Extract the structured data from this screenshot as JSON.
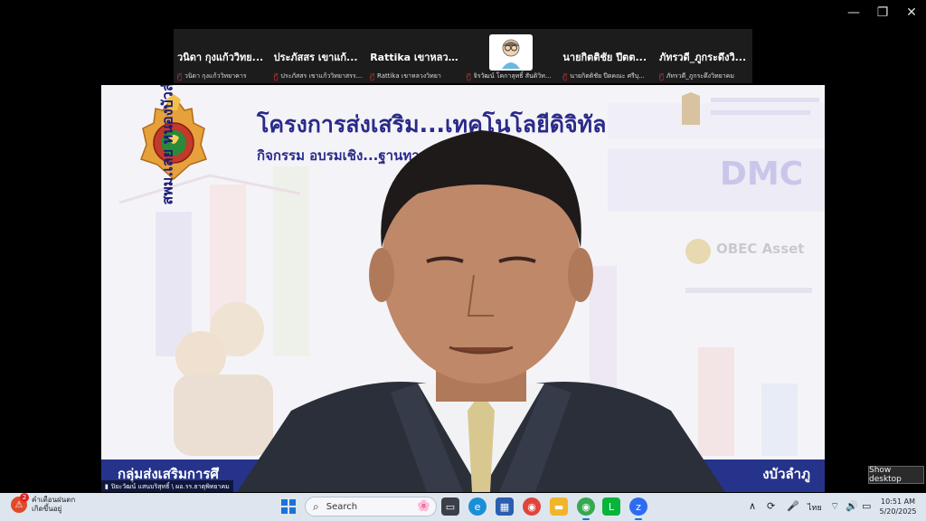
{
  "participants": [
    {
      "name": "วนิดา กุงแก้ววิทย...",
      "sub": "วนิดา กุงแก้ววิทยาคาร"
    },
    {
      "name": "ประภัสสร เขาแก้...",
      "sub": "ประภัสสร เขาแก้ววิทยาสรร..."
    },
    {
      "name": "Rattika เขาหลวง...",
      "sub": "Rattika เขาหลวงวิทยา"
    },
    {
      "name": "",
      "sub": "จิรวัฒน์ โคกาลุทธิ์ สันติวิท..."
    },
    {
      "name": "นายกิตติชัย ปีตต...",
      "sub": "นายกิตติชัย ปีตคณะ ศรีบุ..."
    },
    {
      "name": "ภัทรวดี_ภูกระดึงวิ...",
      "sub": "ภัทรวดี_ภูกระดึงวิทยาคม"
    }
  ],
  "slide": {
    "title": "โครงการส่งเสริม...เทคโนโลยีดิจิทัล",
    "subtitle": "กิจกรรม อบรมเชิง...ฐานทางการศึกษา",
    "logo_vertical_text": "สพม.เลย หนองบัวลำภู",
    "dmc": "DMC",
    "obec": "OBEC Asset",
    "footer_left": "กลุ่มส่งเสริมการศึ",
    "footer_right": "งบัวลำภู"
  },
  "speaker_tag": "ปิยะวัฒน์ แสนบริสุทธิ์ \\ ผอ.รร.ธาตุพิทยาคม",
  "show_desktop": "Show desktop",
  "taskbar": {
    "weather_line1": "คำเตือนฝนตก",
    "weather_line2": "เกิดขึ้นอยู่",
    "weather_badge": "2",
    "search_placeholder": "Search",
    "language": "ไทย",
    "time": "10:51 AM",
    "date": "5/20/2025"
  },
  "colors": {
    "accent": "#1a73d9",
    "slide_title": "#2a2a8a",
    "footer_band": "#25338a"
  }
}
